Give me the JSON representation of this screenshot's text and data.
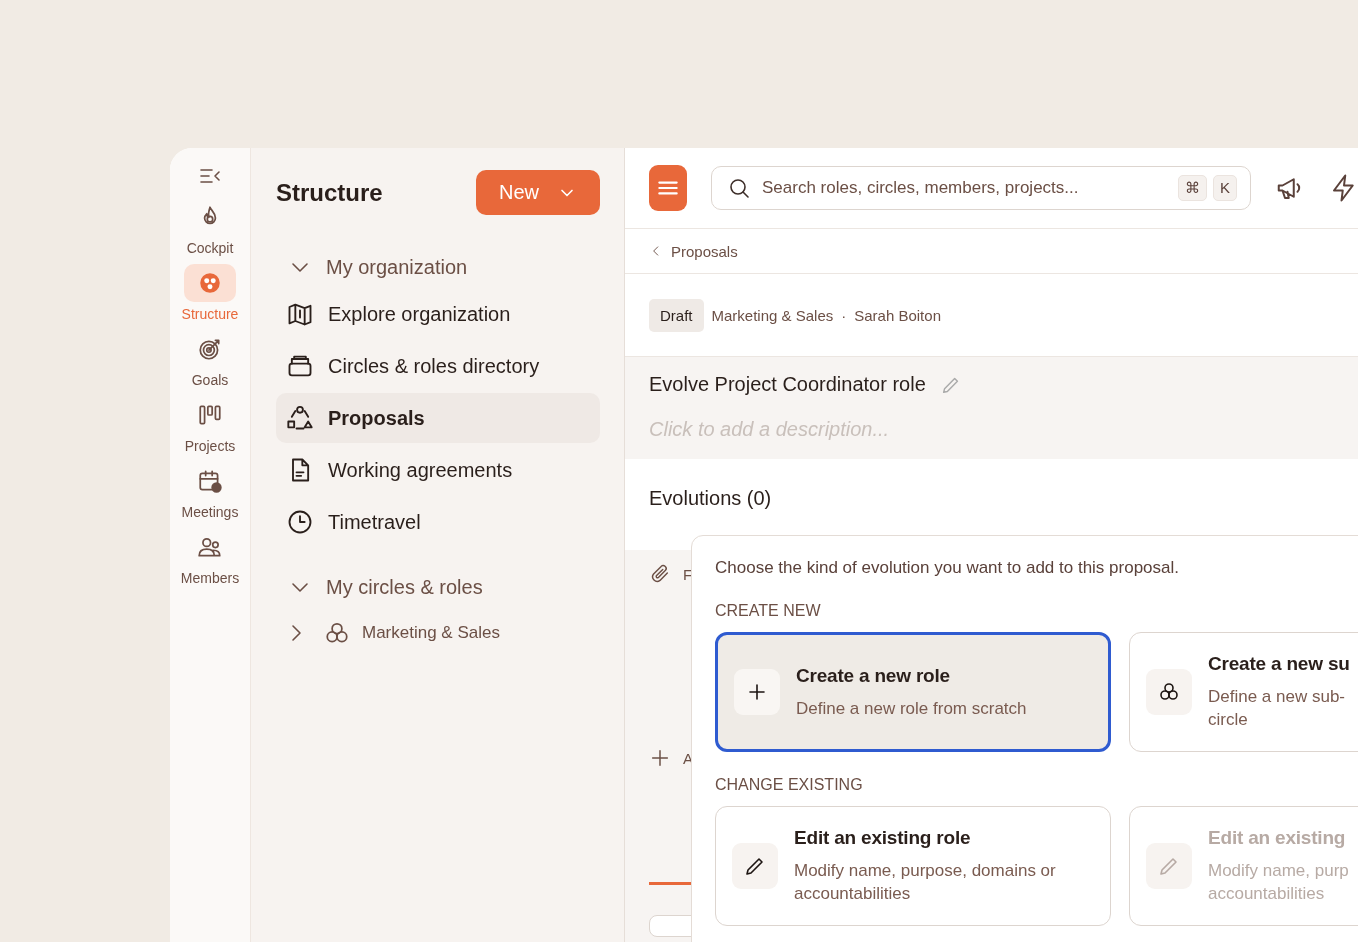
{
  "rail": {
    "items": [
      {
        "label": "Cockpit",
        "selected": false
      },
      {
        "label": "Structure",
        "selected": true
      },
      {
        "label": "Goals",
        "selected": false
      },
      {
        "label": "Projects",
        "selected": false
      },
      {
        "label": "Meetings",
        "selected": false
      },
      {
        "label": "Members",
        "selected": false
      }
    ]
  },
  "nav": {
    "title": "Structure",
    "new_button": "New",
    "sections": [
      {
        "label": "My organization",
        "expanded": true,
        "children": [
          {
            "label": "Explore organization",
            "selected": false
          },
          {
            "label": "Circles & roles directory",
            "selected": false
          },
          {
            "label": "Proposals",
            "selected": true
          },
          {
            "label": "Working agreements",
            "selected": false
          },
          {
            "label": "Timetravel",
            "selected": false
          }
        ]
      },
      {
        "label": "My circles & roles",
        "expanded": true,
        "children": [
          {
            "label": "Marketing & Sales",
            "expanded": false
          }
        ]
      }
    ]
  },
  "search": {
    "placeholder": "Search roles, circles, members, projects...",
    "keys": [
      "⌘",
      "K"
    ]
  },
  "breadcrumb": "Proposals",
  "proposal": {
    "status": "Draft",
    "circle": "Marketing & Sales",
    "separator": "·",
    "author": "Sarah Boiton",
    "title": "Evolve Project Coordinator role",
    "description_placeholder": "Click to add a description..."
  },
  "evolutions": {
    "heading": "Evolutions (0)",
    "hidden_rows": [
      "F",
      "A"
    ]
  },
  "popover": {
    "intro": "Choose the kind of evolution you want to add to this proposal.",
    "sections": [
      {
        "heading": "CREATE NEW",
        "cards": [
          {
            "title": "Create a new role",
            "lines": [
              "Define a new role from scratch"
            ],
            "selected": true,
            "disabled": false
          },
          {
            "title": "Create a new su",
            "lines": [
              "Define a new sub-",
              "circle"
            ],
            "selected": false,
            "disabled": false
          }
        ]
      },
      {
        "heading": "CHANGE EXISTING",
        "cards": [
          {
            "title": "Edit an existing role",
            "lines": [
              "Modify name, purpose, domains or",
              "accountabilities"
            ],
            "selected": false,
            "disabled": false
          },
          {
            "title": "Edit an existing",
            "lines": [
              "Modify name, purp",
              "accountabilities"
            ],
            "selected": false,
            "disabled": true
          }
        ]
      }
    ]
  }
}
